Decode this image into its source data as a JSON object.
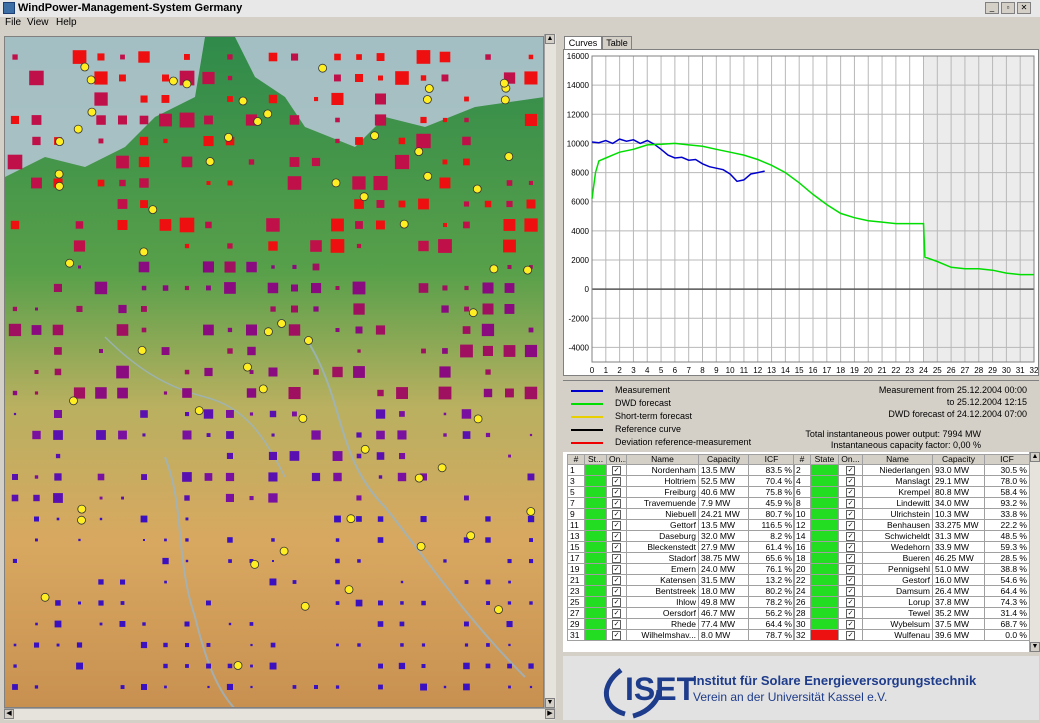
{
  "window": {
    "title": "WindPower-Management-System Germany"
  },
  "menu": [
    "File",
    "View",
    "Help"
  ],
  "tabs": [
    {
      "label": "Curves",
      "active": true
    },
    {
      "label": "Table",
      "active": false
    }
  ],
  "chart_data": {
    "type": "line",
    "y_ticks": [
      16000,
      14000,
      12000,
      10000,
      8000,
      6000,
      4000,
      2000,
      0,
      -2000,
      -4000
    ],
    "x_ticks": [
      0,
      1,
      2,
      3,
      4,
      5,
      6,
      7,
      8,
      9,
      10,
      11,
      12,
      13,
      14,
      15,
      16,
      17,
      18,
      19,
      20,
      21,
      22,
      23,
      24,
      25,
      26,
      27,
      28,
      29,
      30,
      31,
      32
    ],
    "ylim": [
      -5000,
      16000
    ],
    "xlim": [
      0,
      32
    ],
    "grid": true,
    "shaded_from_x": 24,
    "series": [
      {
        "name": "Measurement",
        "color": "#0000cc",
        "x": [
          0,
          0.5,
          1,
          1.5,
          2,
          2.5,
          3,
          3.5,
          4,
          4.5,
          5,
          5.5,
          6,
          6.5,
          7,
          7.5,
          8,
          8.5,
          9,
          9.5,
          10,
          10.5,
          11,
          11.5,
          12,
          12.5
        ],
        "y": [
          10100,
          10050,
          10200,
          10000,
          10300,
          10150,
          10250,
          10000,
          10200,
          9950,
          9600,
          9200,
          9000,
          9050,
          8850,
          8900,
          8600,
          8400,
          8300,
          8200,
          7900,
          7400,
          7500,
          7900,
          8000,
          8100
        ]
      },
      {
        "name": "DWD forecast",
        "color": "#00dd00",
        "x": [
          0,
          0.25,
          0.5,
          1,
          1.5,
          2,
          3,
          4,
          5,
          6,
          7,
          8,
          9,
          10,
          11,
          12,
          13,
          14,
          15,
          16,
          17,
          18,
          19,
          20,
          21,
          22,
          23,
          24,
          24.1,
          25,
          26,
          27,
          28,
          29,
          30,
          31,
          32
        ],
        "y": [
          6200,
          8000,
          8800,
          9000,
          9200,
          9400,
          9600,
          9900,
          9950,
          10000,
          9900,
          9800,
          9600,
          9400,
          9200,
          8900,
          8500,
          8000,
          7300,
          6500,
          5800,
          5200,
          4900,
          4700,
          4600,
          4500,
          4500,
          4500,
          2200,
          1900,
          1500,
          1400,
          1400,
          1300,
          1100,
          1000,
          1000
        ]
      }
    ]
  },
  "legend": [
    {
      "label": "Measurement",
      "color": "#0000cc"
    },
    {
      "label": "DWD forecast",
      "color": "#00dd00"
    },
    {
      "label": "Short-term forecast",
      "color": "#e8d000"
    },
    {
      "label": "Reference curve",
      "color": "#000000"
    },
    {
      "label": "Deviation reference-measurement",
      "color": "#ee0000"
    }
  ],
  "info": {
    "measurement_from": "Measurement from 25.12.2004  00:00",
    "measurement_to": "to 25.12.2004  12:15",
    "dwd_forecast": "DWD forecast of 24.12.2004  07:00",
    "total_power": "Total instantaneous power output:   7994 MW",
    "capacity_factor": "Instantaneous capacity factor:        0,00 %"
  },
  "table": {
    "headers": [
      "#",
      "St...",
      "On...",
      "Name",
      "Capacity",
      "ICF"
    ],
    "headers_right": [
      "#",
      "State",
      "On...",
      "Name",
      "Capacity",
      "ICF"
    ],
    "left_rows": [
      {
        "n": "1",
        "state": "#22dd22",
        "name": "Nordenham",
        "cap": "13.5 MW",
        "icf": "83.5 %"
      },
      {
        "n": "3",
        "state": "#22dd22",
        "name": "Holtriem",
        "cap": "52.5 MW",
        "icf": "70.4 %"
      },
      {
        "n": "5",
        "state": "#22dd22",
        "name": "Freiburg",
        "cap": "40.6 MW",
        "icf": "75.8 %"
      },
      {
        "n": "7",
        "state": "#22dd22",
        "name": "Travemuende",
        "cap": "7.9 MW",
        "icf": "45.9 %"
      },
      {
        "n": "9",
        "state": "#22dd22",
        "name": "Niebuell",
        "cap": "24.21 MW",
        "icf": "80.7 %"
      },
      {
        "n": "11",
        "state": "#22dd22",
        "name": "Gettorf",
        "cap": "13.5 MW",
        "icf": "116.5 %"
      },
      {
        "n": "13",
        "state": "#22dd22",
        "name": "Daseburg",
        "cap": "32.0 MW",
        "icf": "8.2 %"
      },
      {
        "n": "15",
        "state": "#22dd22",
        "name": "Bleckenstedt",
        "cap": "27.9 MW",
        "icf": "61.4 %"
      },
      {
        "n": "17",
        "state": "#22dd22",
        "name": "Stadorf",
        "cap": "38.75 MW",
        "icf": "65.6 %"
      },
      {
        "n": "19",
        "state": "#22dd22",
        "name": "Emern",
        "cap": "24.0 MW",
        "icf": "76.1 %"
      },
      {
        "n": "21",
        "state": "#22dd22",
        "name": "Katensen",
        "cap": "31.5 MW",
        "icf": "13.2 %"
      },
      {
        "n": "23",
        "state": "#22dd22",
        "name": "Bentstreek",
        "cap": "18.0 MW",
        "icf": "80.2 %"
      },
      {
        "n": "25",
        "state": "#22dd22",
        "name": "Ihlow",
        "cap": "49.8 MW",
        "icf": "78.2 %"
      },
      {
        "n": "27",
        "state": "#22dd22",
        "name": "Oersdorf",
        "cap": "46.7 MW",
        "icf": "56.2 %"
      },
      {
        "n": "29",
        "state": "#22dd22",
        "name": "Rhede",
        "cap": "77.4 MW",
        "icf": "64.4 %"
      },
      {
        "n": "31",
        "state": "#22dd22",
        "name": "Wilhelmshav...",
        "cap": "8.0 MW",
        "icf": "78.7 %"
      }
    ],
    "right_rows": [
      {
        "n": "2",
        "state": "#22dd22",
        "name": "Niederlangen",
        "cap": "93.0 MW",
        "icf": "30.5 %"
      },
      {
        "n": "4",
        "state": "#22dd22",
        "name": "Manslagt",
        "cap": "29.1 MW",
        "icf": "78.0 %"
      },
      {
        "n": "6",
        "state": "#22dd22",
        "name": "Krempel",
        "cap": "80.8 MW",
        "icf": "58.4 %"
      },
      {
        "n": "8",
        "state": "#22dd22",
        "name": "Lindewitt",
        "cap": "34.0 MW",
        "icf": "93.2 %"
      },
      {
        "n": "10",
        "state": "#22dd22",
        "name": "Ulrichstein",
        "cap": "10.3 MW",
        "icf": "33.8 %"
      },
      {
        "n": "12",
        "state": "#22dd22",
        "name": "Benhausen",
        "cap": "33.275 MW",
        "icf": "22.2 %"
      },
      {
        "n": "14",
        "state": "#22dd22",
        "name": "Schwicheldt",
        "cap": "31.3 MW",
        "icf": "48.5 %"
      },
      {
        "n": "16",
        "state": "#22dd22",
        "name": "Wedehorn",
        "cap": "33.9 MW",
        "icf": "59.3 %"
      },
      {
        "n": "18",
        "state": "#22dd22",
        "name": "Bueren",
        "cap": "46.25 MW",
        "icf": "28.5 %"
      },
      {
        "n": "20",
        "state": "#22dd22",
        "name": "Pennigsehl",
        "cap": "51.0 MW",
        "icf": "38.8 %"
      },
      {
        "n": "22",
        "state": "#22dd22",
        "name": "Gestorf",
        "cap": "16.0 MW",
        "icf": "54.6 %"
      },
      {
        "n": "24",
        "state": "#22dd22",
        "name": "Damsum",
        "cap": "26.4 MW",
        "icf": "64.4 %"
      },
      {
        "n": "26",
        "state": "#22dd22",
        "name": "Lorup",
        "cap": "37.8 MW",
        "icf": "74.3 %"
      },
      {
        "n": "28",
        "state": "#22dd22",
        "name": "Tewel",
        "cap": "35.2 MW",
        "icf": "31.4 %"
      },
      {
        "n": "30",
        "state": "#22dd22",
        "name": "Wybelsum",
        "cap": "37.5 MW",
        "icf": "68.7 %"
      },
      {
        "n": "32",
        "state": "#ee1111",
        "name": "Wulfenau",
        "cap": "39.6 MW",
        "icf": "0.0 %"
      }
    ]
  },
  "logo": {
    "acronym": "ISET",
    "line1": "Institut für Solare Energieversorgungstechnik",
    "line2": "Verein an der Universität Kassel e.V."
  }
}
